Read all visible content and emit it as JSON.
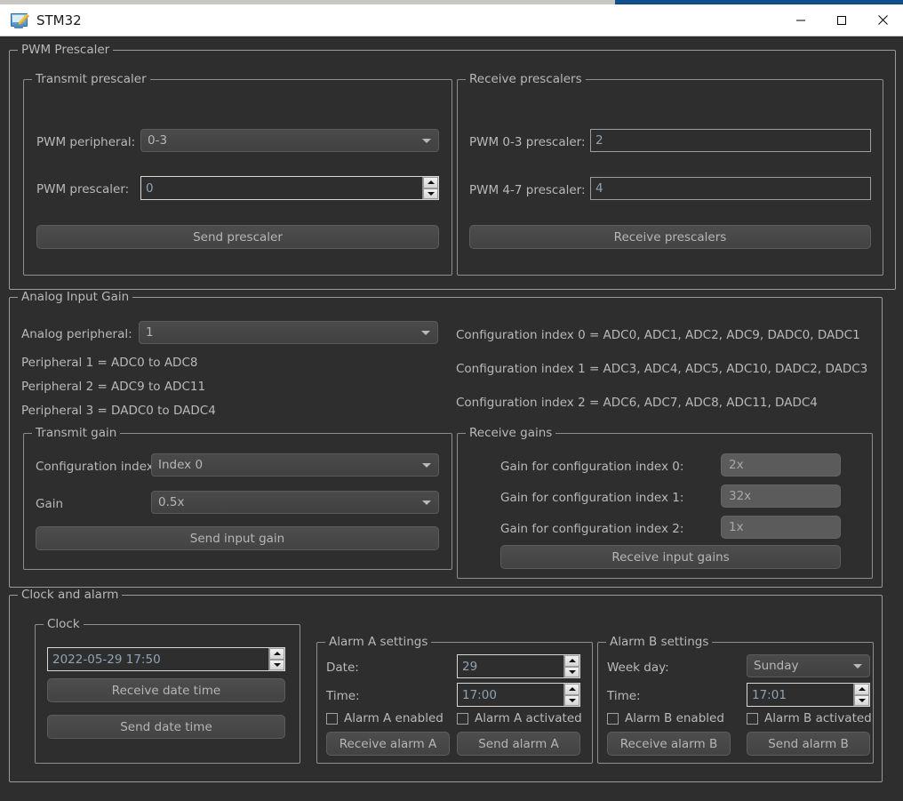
{
  "window": {
    "title": "STM32",
    "icon": "app-window-pencil-icon",
    "controls": {
      "minimize": "–",
      "maximize": "☐",
      "close": "✕"
    }
  },
  "pwm_prescaler": {
    "title": "PWM Prescaler",
    "transmit": {
      "title": "Transmit prescaler",
      "peripheral_label": "PWM peripheral:",
      "peripheral_value": "0-3",
      "prescaler_label": "PWM prescaler:",
      "prescaler_value": "0",
      "send_button": "Send prescaler"
    },
    "receive": {
      "title": "Receive prescalers",
      "pwm03_label": "PWM 0-3 prescaler:",
      "pwm03_value": "2",
      "pwm47_label": "PWM 4-7 prescaler:",
      "pwm47_value": "4",
      "receive_button": "Receive prescalers"
    }
  },
  "analog_input_gain": {
    "title": "Analog Input Gain",
    "peripheral_label": "Analog peripheral:",
    "peripheral_value": "1",
    "peripheral_info": [
      "Peripheral 1 = ADC0 to ADC8",
      "Peripheral 2 = ADC9 to ADC11",
      "Peripheral 3 = DADC0 to DADC4"
    ],
    "config_info": [
      "Configuration index 0 = ADC0, ADC1, ADC2, ADC9, DADC0, DADC1",
      "Configuration index 1 = ADC3, ADC4, ADC5, ADC10, DADC2, DADC3",
      "Configuration index 2 = ADC6, ADC7, ADC8, ADC11, DADC4"
    ],
    "transmit": {
      "title": "Transmit gain",
      "config_label": "Configuration index:",
      "config_value": "Index 0",
      "gain_label": "Gain",
      "gain_value": "0.5x",
      "send_button": "Send input gain"
    },
    "receive": {
      "title": "Receive gains",
      "gain0_label": "Gain for configuration index 0:",
      "gain0_value": "2x",
      "gain1_label": "Gain for configuration index 1:",
      "gain1_value": "32x",
      "gain2_label": "Gain for configuration index 2:",
      "gain2_value": "1x",
      "receive_button": "Receive input gains"
    }
  },
  "clock_and_alarm": {
    "title": "Clock and alarm",
    "clock": {
      "title": "Clock",
      "datetime_value": "2022-05-29 17:50",
      "receive_button": "Receive date time",
      "send_button": "Send date time"
    },
    "alarm_a": {
      "title": "Alarm A settings",
      "date_label": "Date:",
      "date_value": "29",
      "time_label": "Time:",
      "time_value": "17:00",
      "enabled_label": "Alarm A enabled",
      "activated_label": "Alarm A activated",
      "receive_button": "Receive alarm A",
      "send_button": "Send alarm A"
    },
    "alarm_b": {
      "title": "Alarm B settings",
      "weekday_label": "Week day:",
      "weekday_value": "Sunday",
      "time_label": "Time:",
      "time_value": "17:01",
      "enabled_label": "Alarm B enabled",
      "activated_label": "Alarm B activated",
      "receive_button": "Receive alarm B",
      "send_button": "Send alarm B"
    }
  },
  "colors": {
    "window_bg": "#2e2e2e",
    "titlebar_bg": "#ffffff",
    "text": "#b9b9b9",
    "field_text": "#8fa3b5",
    "group_border": "#9a9a9a",
    "accent_blue": "#12508f"
  }
}
